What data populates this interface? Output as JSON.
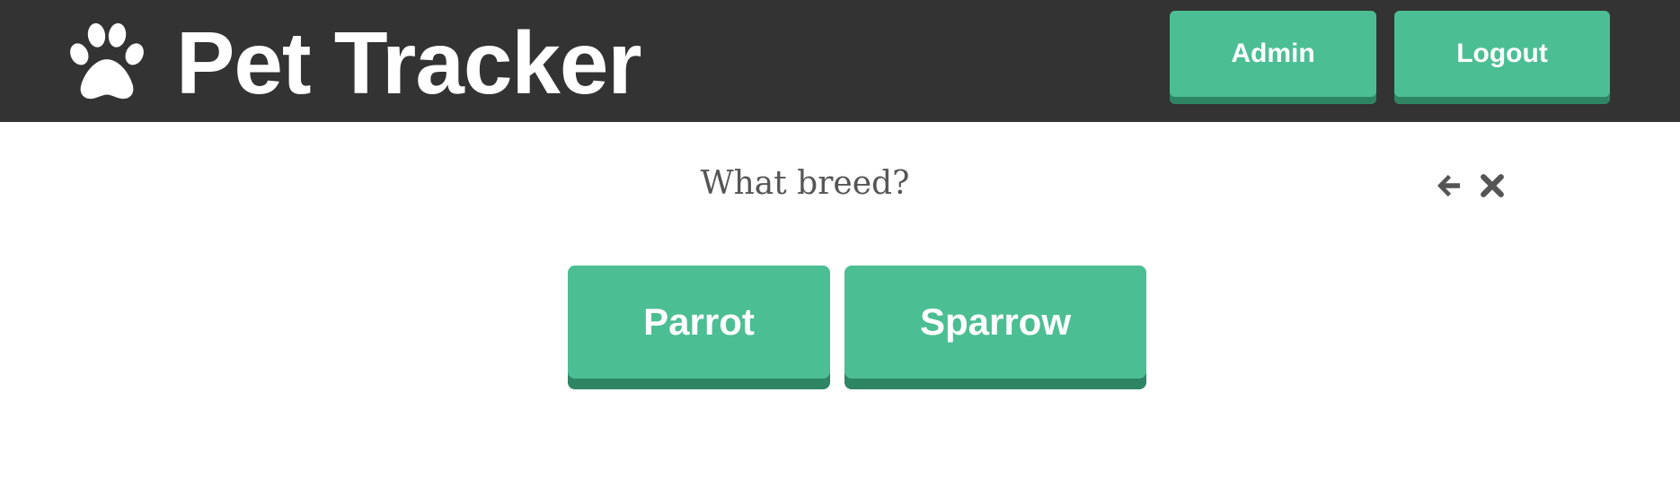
{
  "header": {
    "logo_icon": "paw-icon",
    "title": "Pet Tracker",
    "admin_label": "Admin",
    "logout_label": "Logout",
    "background_color": "#333333",
    "button_color": "#4cbe93"
  },
  "prompt": {
    "question": "What breed?",
    "back_icon": "arrow-left-icon",
    "close_icon": "close-icon"
  },
  "choices": [
    {
      "label": "Parrot"
    },
    {
      "label": "Sparrow"
    }
  ]
}
